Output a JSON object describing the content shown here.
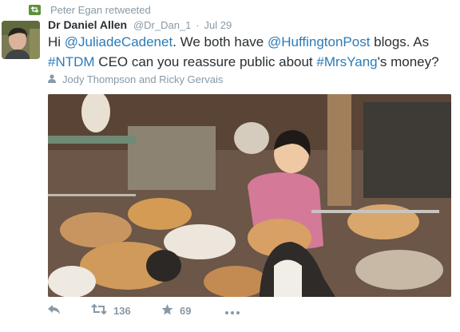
{
  "retweet_context": {
    "text": "Peter Egan retweeted"
  },
  "tweet": {
    "author_name": "Dr Daniel Allen",
    "handle": "@Dr_Dan_1",
    "separator": "·",
    "time": "Jul 29",
    "text_parts": {
      "p1": "Hi ",
      "mention1": "@JuliadeCadenet",
      "p2": ". We both have ",
      "mention2": "@HuffingtonPost",
      "p3": " blogs. As",
      "hashtag1": "#NTDM",
      "p4": " CEO can you reassure public about ",
      "hashtag2": "#MrsYang",
      "p5": "'s money?"
    },
    "people_context": "Jody Thompson and Ricky Gervais"
  },
  "actions": {
    "retweet_count": "136",
    "favorite_count": "69"
  },
  "colors": {
    "link": "#2b7bb9",
    "muted": "#8899a6",
    "retweet_badge": "#5c913b"
  },
  "icons": [
    "retweet-icon",
    "person-icon",
    "reply-icon",
    "retweet-action-icon",
    "star-icon",
    "more-icon"
  ]
}
